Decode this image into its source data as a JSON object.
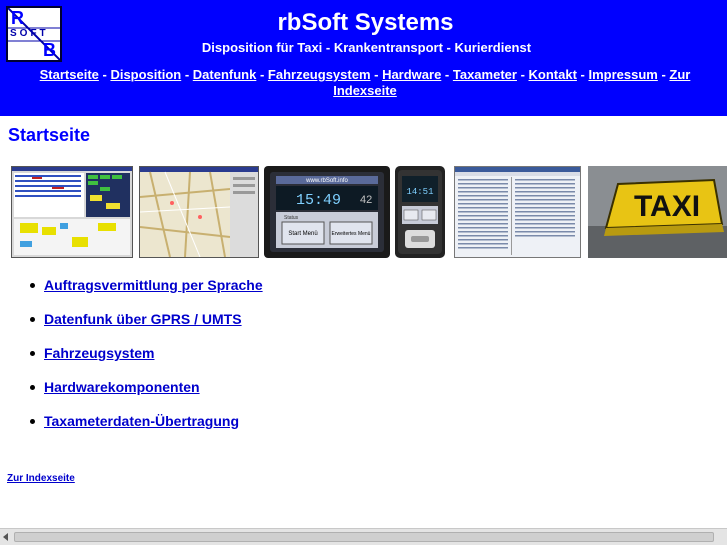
{
  "header": {
    "logo_letters": [
      "R",
      "SOFT",
      "B"
    ],
    "title": "rbSoft Systems",
    "tagline": "Disposition für Taxi - Krankentransport - Kurierdienst",
    "nav": [
      "Startseite",
      "Disposition",
      "Datenfunk",
      "Fahrzeugsystem",
      "Hardware",
      "Taxameter",
      "Kontakt",
      "Impressum",
      "Zur Indexseite"
    ],
    "separator": " - "
  },
  "main": {
    "heading": "Startseite",
    "features": [
      "Auftragsvermittlung per Sprache",
      "Datenfunk über GPRS / UMTS",
      "Fahrzeugsystem",
      "Hardwarekomponenten",
      "Taxameterdaten-Übertragung"
    ],
    "footer_link": "Zur Indexseite"
  },
  "screenshots": {
    "device_url": "www.rbSoft.info",
    "clock": "15:49",
    "device_number": "42",
    "status_label": "Status",
    "btn_start": "Start Menü",
    "btn_extended": "Erweitertes Menü",
    "small_device_time": "14:51",
    "taxi_sign": "TAXI"
  },
  "colors": {
    "header_bg": "#0000ff",
    "link": "#0000cc",
    "heading": "#0000ff"
  }
}
